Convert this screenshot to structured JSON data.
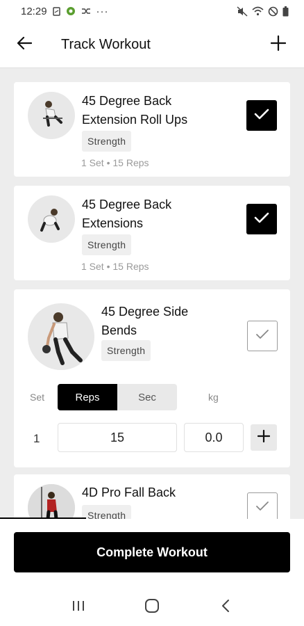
{
  "status_bar": {
    "time": "12:29",
    "dots": "···"
  },
  "header": {
    "title": "Track Workout",
    "back_icon": "arrow-left-icon",
    "add_icon": "plus-icon"
  },
  "exercises": [
    {
      "title_line1": "45 Degree Back",
      "title_line2": "Extension Roll Ups",
      "tag": "Strength",
      "meta": "1 Set • 15 Reps",
      "checked": true
    },
    {
      "title_line1": "45 Degree Back",
      "title_line2": "Extensions",
      "tag": "Strength",
      "meta": "1 Set • 15 Reps",
      "checked": true
    },
    {
      "title_line1": "45 Degree Side",
      "title_line2": "Bends",
      "tag": "Strength",
      "checked": false,
      "table": {
        "set_label": "Set",
        "reps_label": "Reps",
        "sec_label": "Sec",
        "kg_label": "kg",
        "active_mode": "Reps",
        "rows": [
          {
            "set": "1",
            "reps": "15",
            "kg": "0.0"
          }
        ]
      }
    },
    {
      "title_line1": "4D Pro Fall Back",
      "tag": "Strength",
      "checked": false
    }
  ],
  "footer": {
    "complete_label": "Complete Workout"
  },
  "colors": {
    "accent": "#000000",
    "background": "#ededed",
    "card": "#ffffff"
  }
}
